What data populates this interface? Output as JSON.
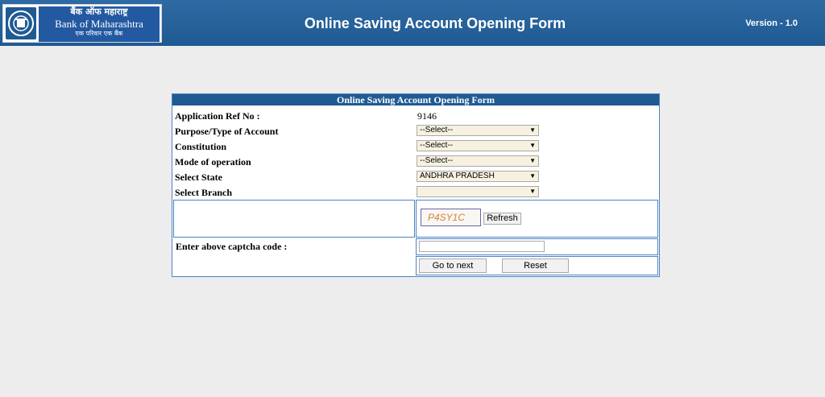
{
  "header": {
    "logo_hindi": "बैंक ऑफ महाराष्ट्र",
    "logo_english": "Bank of Maharashtra",
    "logo_tagline": "एक परिवार एक बैंक",
    "title": "Online Saving Account Opening Form",
    "version": "Version - 1.0"
  },
  "form": {
    "title": "Online Saving Account Opening Form",
    "app_ref_label": "Application Ref No :",
    "app_ref_value": "9146",
    "purpose_label": "Purpose/Type of Account",
    "purpose_value": "--Select--",
    "constitution_label": "Constitution",
    "constitution_value": "--Select--",
    "mode_label": "Mode of operation",
    "mode_value": "--Select--",
    "state_label": "Select State",
    "state_value": "ANDHRA PRADESH",
    "branch_label": "Select Branch",
    "branch_value": "",
    "captcha_text": "P4SY1C",
    "refresh_label": "Refresh",
    "captcha_entry_label": "Enter above captcha code :",
    "captcha_input_value": "",
    "next_label": "Go to next",
    "reset_label": "Reset"
  }
}
